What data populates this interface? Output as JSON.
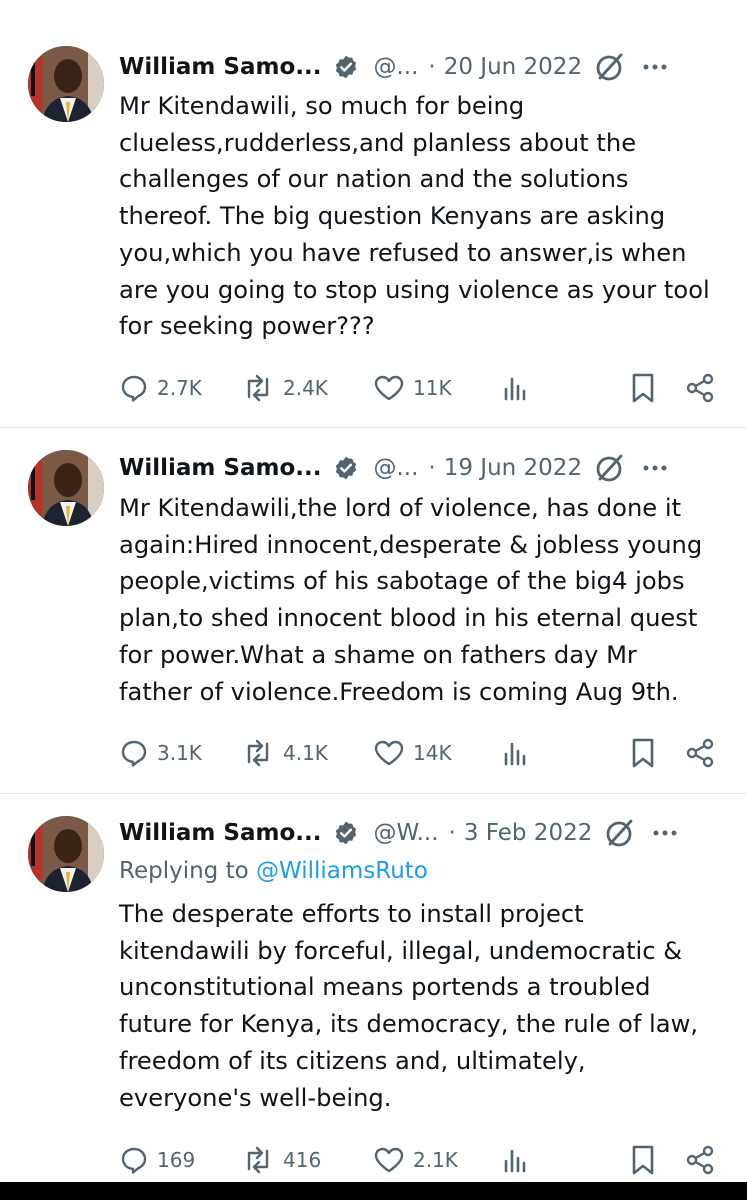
{
  "tweets": [
    {
      "name": "William Samo...",
      "handle": "@...",
      "dot": "·",
      "date": "20 Jun 2022",
      "reply_label": "",
      "reply_mention": "",
      "text": "Mr Kitendawili, so much for being\nclueless,rudderless,and planless about the\nchallenges of our nation and the solutions\nthereof. The big question Kenyans are asking\nyou,which you have refused to answer,is when\nare you going to stop using violence as your tool\nfor seeking power???",
      "replies": "2.7K",
      "reposts": "2.4K",
      "likes": "11K"
    },
    {
      "name": "William Samo...",
      "handle": "@...",
      "dot": "·",
      "date": "19 Jun 2022",
      "reply_label": "",
      "reply_mention": "",
      "text": "Mr Kitendawili,the lord of violence, has done it\nagain:Hired innocent,desperate & jobless young\npeople,victims of his sabotage of the big4 jobs\nplan,to shed innocent blood in his eternal quest\nfor power.What a shame on fathers day Mr\nfather of violence.Freedom is coming Aug 9th.",
      "replies": "3.1K",
      "reposts": "4.1K",
      "likes": "14K"
    },
    {
      "name": "William Samo...",
      "handle": "@W...",
      "dot": "·",
      "date": "3 Feb 2022",
      "reply_label": "Replying to ",
      "reply_mention": "@WilliamsRuto",
      "text": "The desperate efforts to install project\nkitendawili by forceful, illegal, undemocratic &\nunconstitutional means portends a troubled\nfuture for Kenya, its democracy, the rule of law,\nfreedom of its citizens and, ultimately,\neveryone's well-being.",
      "replies": "169",
      "reposts": "416",
      "likes": "2.1K"
    }
  ],
  "icons": {
    "reply": "reply-icon",
    "repost": "repost-icon",
    "like": "heart-icon",
    "views": "views-icon",
    "bookmark": "bookmark-icon",
    "share": "share-icon",
    "verified": "verified-badge-icon",
    "grok": "grok-icon",
    "more": "more-icon"
  },
  "colors": {
    "text": "#0f1419",
    "secondary": "#536471",
    "link": "#1d9bf0",
    "divider": "#e6e6e6"
  }
}
